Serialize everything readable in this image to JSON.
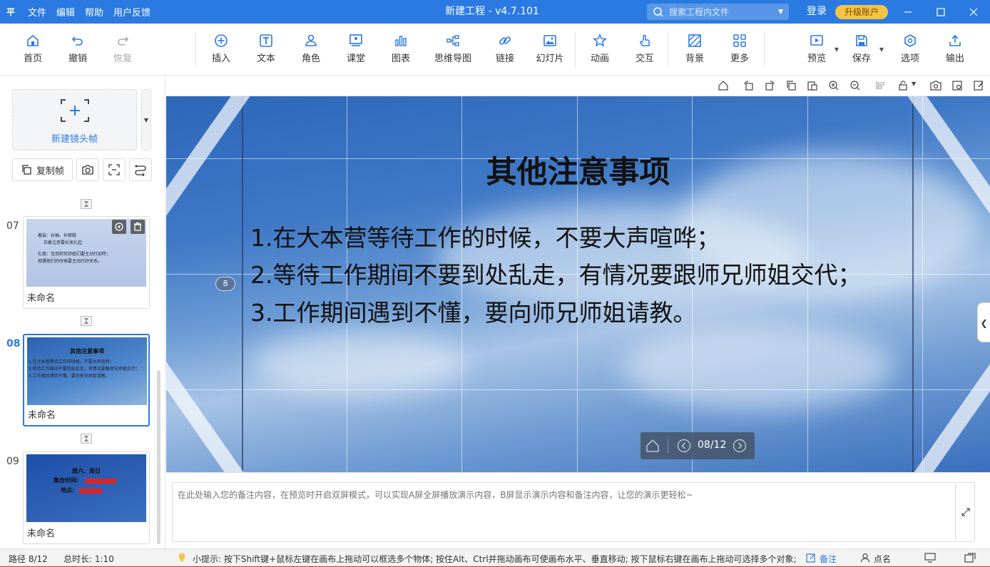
{
  "titlebar": {
    "logo": "平",
    "menu": [
      "文件",
      "编辑",
      "帮助",
      "用户反馈"
    ],
    "title": "新建工程 - v4.7.101",
    "search_placeholder": "搜索工程内文件",
    "login": "登录",
    "upgrade": "升级账户"
  },
  "toolbar": {
    "home": "首页",
    "undo": "撤销",
    "redo": "恢复",
    "insert": "插入",
    "text": "文本",
    "role": "角色",
    "classroom": "课堂",
    "chart": "图表",
    "mindmap": "思维导图",
    "link": "链接",
    "slide": "幻灯片",
    "animation": "动画",
    "interact": "交互",
    "background": "背景",
    "more": "更多",
    "preview": "预览",
    "save": "保存",
    "options": "选项",
    "export": "输出"
  },
  "leftpanel": {
    "new_frame": "新建镜头帧",
    "copy_frame": "复制帧",
    "frames": [
      {
        "num": "07",
        "name": "未命名",
        "thumb_lines": [
          "着装：长袖、长裤鞋",
          "衣着注意要长发扎起",
          "礼貌：见到师兄师姐们要主动打招呼；",
          "    相遇他们的时候要主动打好关系。"
        ]
      },
      {
        "num": "08",
        "name": "未命名",
        "thumb_title": "其他注意事项",
        "thumb_lines": [
          "1.在大本营等待工作的时候，不要大声喧哗；",
          "2.等待工作期间不要到处乱走，有情况要跟师兄师姐交代；",
          "3.工作期间遇到不懂，要向师兄师姐请教。"
        ]
      },
      {
        "num": "09",
        "name": "未命名",
        "thumb_title": "周六、周日",
        "thumb_lines": [
          "集合时间:",
          "地点:"
        ]
      }
    ]
  },
  "canvas": {
    "title": "其他注意事项",
    "lines": [
      "1.在大本营等待工作的时候，不要大声喧哗；",
      "2.等待工作期间不要到处乱走，有情况要跟师兄师姐交代；",
      "3.工作期间遇到不懂，要向师兄师姐请教。"
    ],
    "page_marker": "8",
    "pager": "08/12"
  },
  "notes": {
    "placeholder": "在此处输入您的备注内容，在预览时开启双屏模式，可以实现A屏全屏播放演示内容，B屏显示演示内容和备注内容，让您的演示更轻松~"
  },
  "status": {
    "path": "路径 8/12",
    "duration": "总时长: 1:10",
    "tip": "小提示: 按下Shift键+鼠标左键在画布上拖动可以框选多个物体; 按住Alt、Ctrl并拖动画布可使画布水平、垂直移动; 按下鼠标右键在画布上拖动可选择多个对象;",
    "notes": "备注",
    "rollcall": "点名"
  },
  "colors": {
    "accent": "#2a7ae2",
    "upgrade": "#f6c343"
  }
}
